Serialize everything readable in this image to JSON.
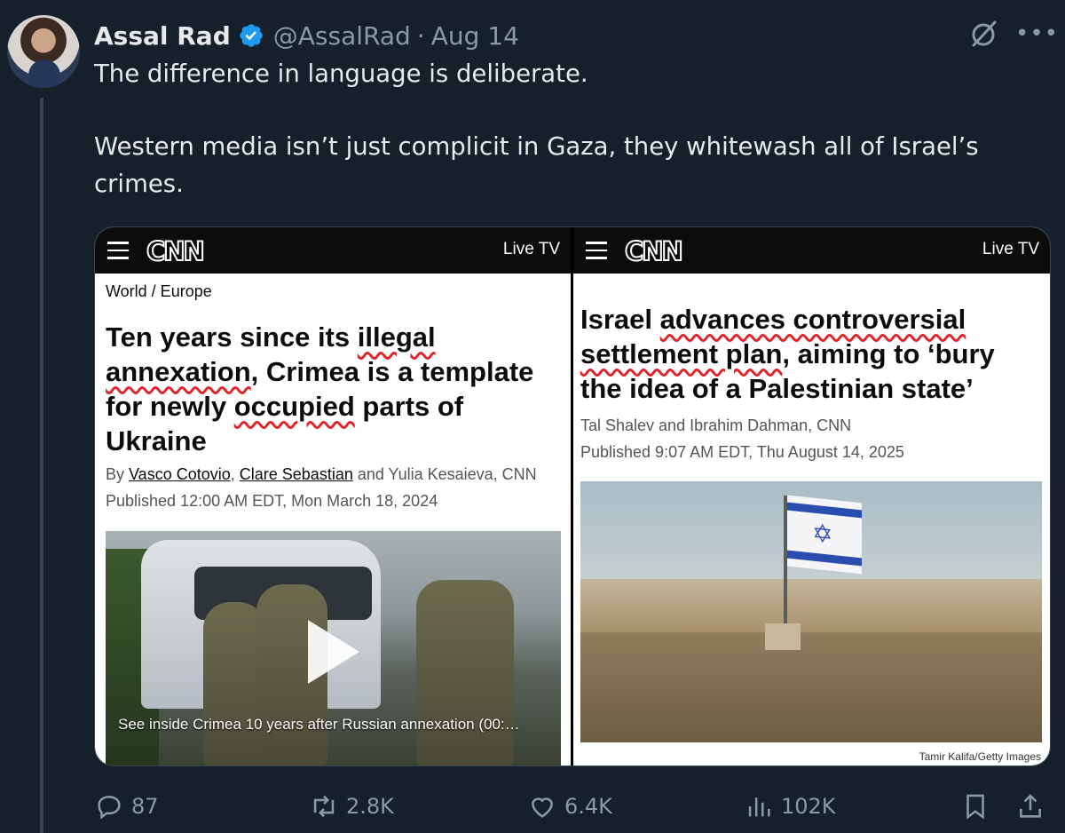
{
  "tweet": {
    "author_name": "Assal Rad",
    "handle": "@AssalRad",
    "separator": "·",
    "date": "Aug 14",
    "more_label": "•••",
    "text_line1": "The difference in language is deliberate.",
    "text_line2": "Western media isn’t just complicit in Gaza, they whitewash all of Israel’s crimes."
  },
  "left_article": {
    "live_tv": "Live TV",
    "logo": "CNN",
    "breadcrumb": "World / Europe",
    "headline": {
      "p1": "Ten years since its ",
      "u1": "illegal",
      "p2": " ",
      "u2": "annexation",
      "p3": ", Crimea is a template for newly ",
      "u3": "occupied",
      "p4": " parts of Ukraine"
    },
    "byline_prefix": "By ",
    "author1": "Vasco Cotovio",
    "comma": ", ",
    "author2": "Clare Sebastian",
    "byline_rest": " and Yulia Kesaieva, CNN",
    "published": "Published 12:00 AM EDT, Mon March 18, 2024",
    "video_caption": "See inside Crimea 10 years after Russian annexation (00:…"
  },
  "right_article": {
    "live_tv": "Live TV",
    "logo": "CNN",
    "headline": {
      "p1": "Israel ",
      "u1": "advances controversial settlement plan",
      "p2": ", aiming to ‘bury the idea of a Palestinian state’"
    },
    "byline": "Tal Shalev and Ibrahim Dahman, CNN",
    "published": "Published 9:07 AM EDT, Thu August 14, 2025",
    "photo_credit": "Tamir Kalifa/Getty Images"
  },
  "actions": {
    "replies": "87",
    "reposts": "2.8K",
    "likes": "6.4K",
    "views": "102K"
  },
  "colors": {
    "background": "#15202b",
    "verified": "#1d9bf0",
    "underline": "#e0262b"
  }
}
